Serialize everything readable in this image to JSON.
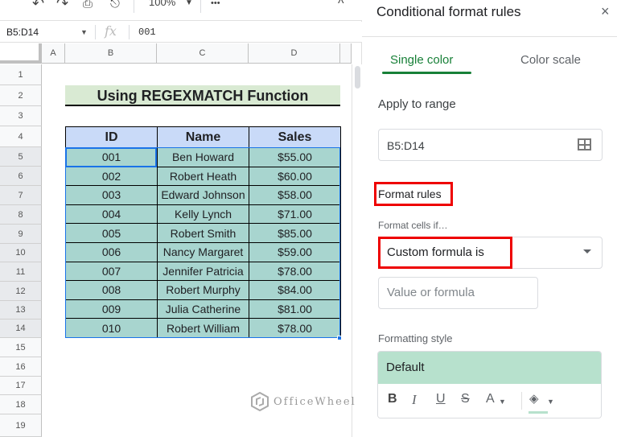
{
  "toolbar": {
    "icons": [
      "undo-icon",
      "redo-icon",
      "print-icon",
      "paint-format-icon"
    ],
    "zoom_value": "100%",
    "more_label": "•••",
    "collapse_label": "^"
  },
  "formula_bar": {
    "name_box": "B5:D14",
    "fx_label": "fx",
    "value": "001"
  },
  "columns": [
    "A",
    "B",
    "C",
    "D"
  ],
  "rows": [
    "1",
    "2",
    "3",
    "4",
    "5",
    "6",
    "7",
    "8",
    "9",
    "10",
    "11",
    "12",
    "13",
    "14",
    "15",
    "16",
    "17",
    "18",
    "19"
  ],
  "sheet": {
    "title": "Using REGEXMATCH Function",
    "headers": [
      "ID",
      "Name",
      "Sales"
    ],
    "data": [
      [
        "001",
        "Ben Howard",
        "$55.00"
      ],
      [
        "002",
        "Robert Heath",
        "$60.00"
      ],
      [
        "003",
        "Edward Johnson",
        "$58.00"
      ],
      [
        "004",
        "Kelly Lynch",
        "$71.00"
      ],
      [
        "005",
        "Robert Smith",
        "$85.00"
      ],
      [
        "006",
        "Nancy Margaret",
        "$59.00"
      ],
      [
        "007",
        "Jennifer Patricia",
        "$78.00"
      ],
      [
        "008",
        "Robert Murphy",
        "$84.00"
      ],
      [
        "009",
        "Julia Catherine",
        "$81.00"
      ],
      [
        "010",
        "Robert William",
        "$78.00"
      ]
    ]
  },
  "watermark": "OfficeWheel",
  "panel": {
    "title": "Conditional format rules",
    "close_label": "×",
    "tabs": [
      {
        "label": "Single color",
        "active": true
      },
      {
        "label": "Color scale",
        "active": false
      }
    ],
    "apply_to_range_label": "Apply to range",
    "range_value": "B5:D14",
    "format_rules_label": "Format rules",
    "format_cells_if_label": "Format cells if…",
    "condition_value": "Custom formula is",
    "value_placeholder": "Value or formula",
    "formatting_style_label": "Formatting style",
    "style_preset": "Default",
    "style_tools": {
      "bold": "B",
      "italic": "I",
      "underline": "U",
      "strikethrough": "S",
      "text_color": "A"
    },
    "colors": {
      "accent": "#188038",
      "highlight": "#e00000",
      "fill": "#b7e1cd"
    }
  }
}
